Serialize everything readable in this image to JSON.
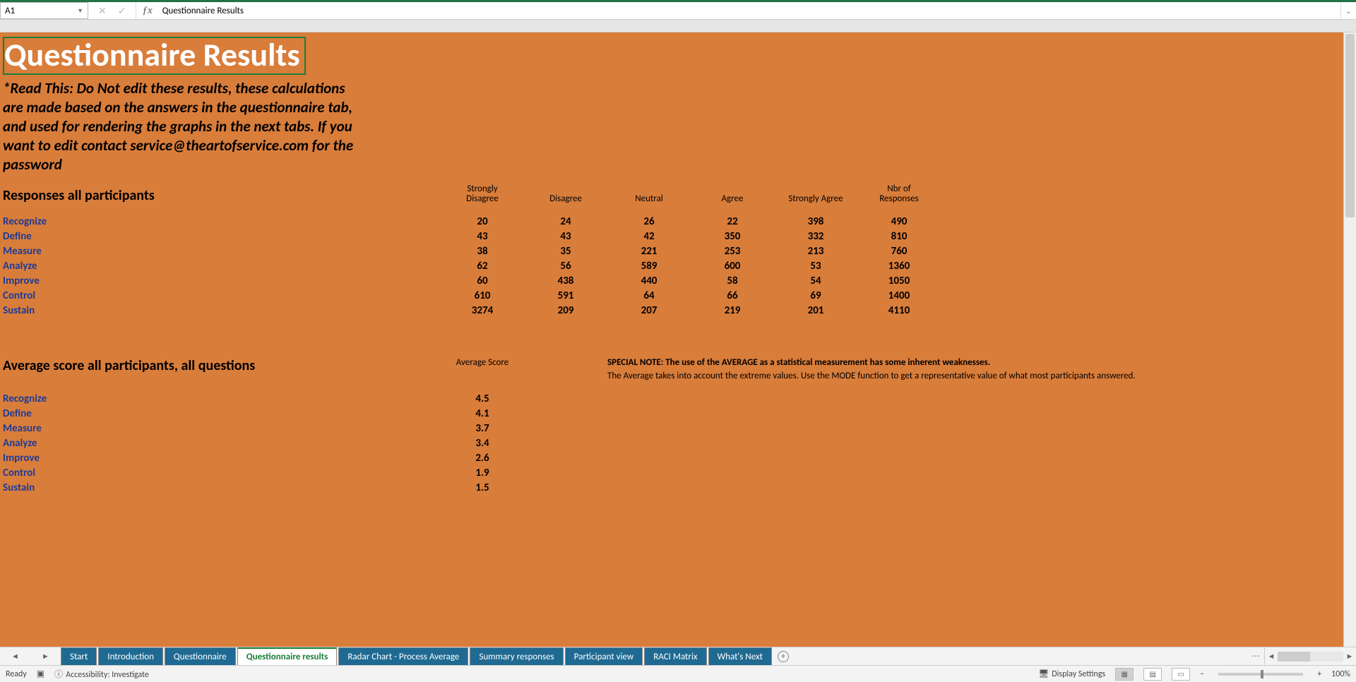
{
  "namebox": {
    "ref": "A1"
  },
  "formula": {
    "value": "Questionnaire Results"
  },
  "sheet": {
    "title": "Questionnaire Results",
    "warning": "*Read This: Do Not edit these results, these calculations are made based on the answers in the questionnaire tab, and used for rendering the graphs in the next tabs. If you want to edit contact service@theartofservice.com for the password",
    "responses_heading": "Responses all participants",
    "headers": {
      "c1a": "Strongly",
      "c1b": "Disagree",
      "c2": "Disagree",
      "c3": "Neutral",
      "c4": "Agree",
      "c5": "Strongly Agree",
      "c6a": "Nbr of",
      "c6b": "Responses"
    },
    "rows": [
      {
        "label": "Recognize",
        "v": [
          "20",
          "24",
          "26",
          "22",
          "398",
          "490"
        ]
      },
      {
        "label": "Define",
        "v": [
          "43",
          "43",
          "42",
          "350",
          "332",
          "810"
        ]
      },
      {
        "label": "Measure",
        "v": [
          "38",
          "35",
          "221",
          "253",
          "213",
          "760"
        ]
      },
      {
        "label": "Analyze",
        "v": [
          "62",
          "56",
          "589",
          "600",
          "53",
          "1360"
        ]
      },
      {
        "label": "Improve",
        "v": [
          "60",
          "438",
          "440",
          "58",
          "54",
          "1050"
        ]
      },
      {
        "label": "Control",
        "v": [
          "610",
          "591",
          "64",
          "66",
          "69",
          "1400"
        ]
      },
      {
        "label": "Sustain",
        "v": [
          "3274",
          "209",
          "207",
          "219",
          "201",
          "4110"
        ]
      }
    ],
    "avg_heading": "Average score all participants, all questions",
    "avg_col_label": "Average Score",
    "avg_rows": [
      {
        "label": "Recognize",
        "v": "4.5"
      },
      {
        "label": "Define",
        "v": "4.1"
      },
      {
        "label": "Measure",
        "v": "3.7"
      },
      {
        "label": "Analyze",
        "v": "3.4"
      },
      {
        "label": "Improve",
        "v": "2.6"
      },
      {
        "label": "Control",
        "v": "1.9"
      },
      {
        "label": "Sustain",
        "v": "1.5"
      }
    ],
    "note_bold": "SPECIAL NOTE: The use of the AVERAGE as a statistical measurement has some inherent weaknesses.",
    "note_text": "The Average takes into account the extreme values. Use the MODE function to get a representative value of what most participants answered."
  },
  "tabs": {
    "items": [
      {
        "label": "Start"
      },
      {
        "label": "Introduction"
      },
      {
        "label": "Questionnaire"
      },
      {
        "label": "Questionnaire results",
        "active": true
      },
      {
        "label": "Radar Chart - Process Average"
      },
      {
        "label": "Summary responses"
      },
      {
        "label": "Participant view"
      },
      {
        "label": "RACI Matrix"
      },
      {
        "label": "What's Next"
      }
    ]
  },
  "status": {
    "ready": "Ready",
    "accessibility": "Accessibility: Investigate",
    "display_settings": "Display Settings",
    "zoom": "100%"
  },
  "chart_data": {
    "type": "table",
    "responses": {
      "categories": [
        "Recognize",
        "Define",
        "Measure",
        "Analyze",
        "Improve",
        "Control",
        "Sustain"
      ],
      "columns": [
        "Strongly Disagree",
        "Disagree",
        "Neutral",
        "Agree",
        "Strongly Agree",
        "Nbr of Responses"
      ],
      "values": [
        [
          20,
          24,
          26,
          22,
          398,
          490
        ],
        [
          43,
          43,
          42,
          350,
          332,
          810
        ],
        [
          38,
          35,
          221,
          253,
          213,
          760
        ],
        [
          62,
          56,
          589,
          600,
          53,
          1360
        ],
        [
          60,
          438,
          440,
          58,
          54,
          1050
        ],
        [
          610,
          591,
          64,
          66,
          69,
          1400
        ],
        [
          3274,
          209,
          207,
          219,
          201,
          4110
        ]
      ]
    },
    "average_score": {
      "categories": [
        "Recognize",
        "Define",
        "Measure",
        "Analyze",
        "Improve",
        "Control",
        "Sustain"
      ],
      "values": [
        4.5,
        4.1,
        3.7,
        3.4,
        2.6,
        1.9,
        1.5
      ]
    }
  }
}
